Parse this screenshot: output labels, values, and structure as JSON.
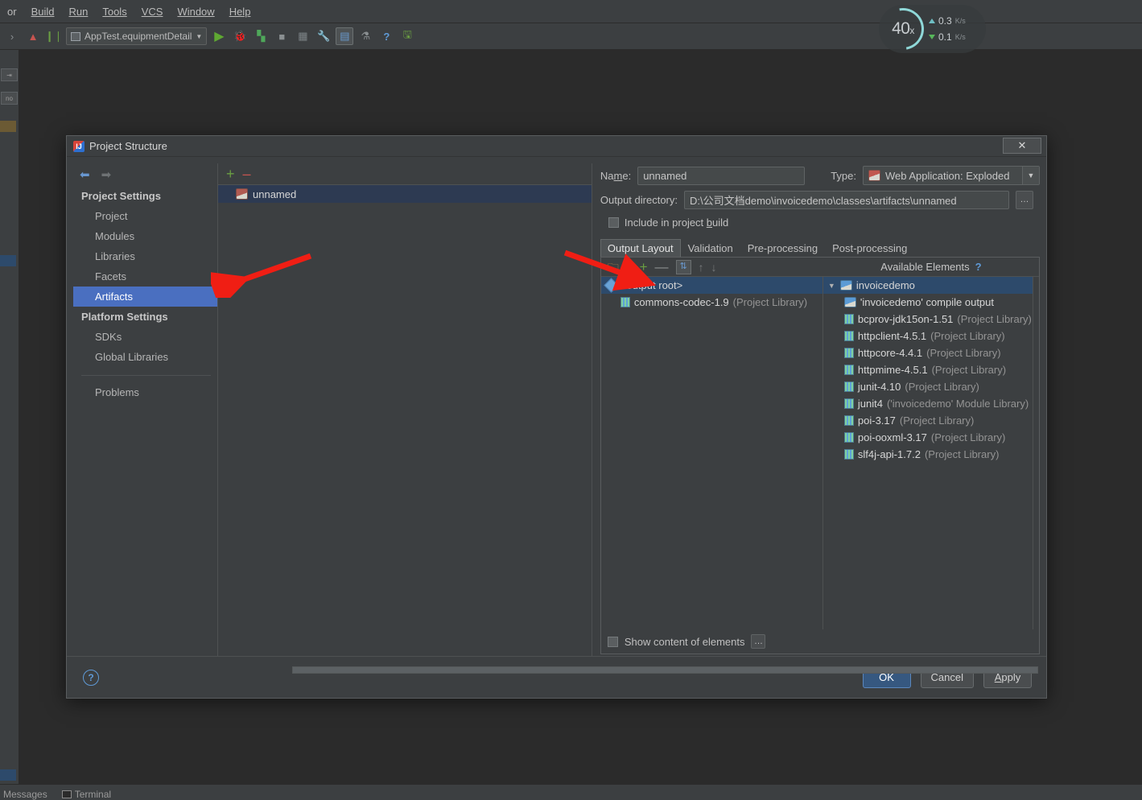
{
  "ide": {
    "menu": [
      "or",
      "Build",
      "Run",
      "Tools",
      "VCS",
      "Window",
      "Help"
    ],
    "run_config": "AppTest.equipmentDetail",
    "toolbar_icons": [
      "update-icon",
      "settings-sync-icon",
      "run-icon",
      "debug-icon",
      "coverage-icon",
      "stop-icon",
      "build-icon",
      "wrench-icon",
      "project-structure-icon",
      "attach-icon",
      "help-icon",
      "save-all-icon"
    ],
    "status_bar": [
      "Messages",
      "Terminal"
    ]
  },
  "net_widget": {
    "percent": "40",
    "percent_unit": "x",
    "upload": "0.3",
    "upload_unit": "K/s",
    "download": "0.1",
    "download_unit": "K/s"
  },
  "dialog": {
    "title": "Project Structure",
    "close_label": "✕",
    "nav": {
      "back": "⬅",
      "forward": "➡"
    },
    "sidebar": {
      "groups": [
        {
          "label": "Project Settings",
          "items": [
            {
              "label": "Project",
              "selected": false
            },
            {
              "label": "Modules",
              "selected": false
            },
            {
              "label": "Libraries",
              "selected": false
            },
            {
              "label": "Facets",
              "selected": false
            },
            {
              "label": "Artifacts",
              "selected": true
            }
          ]
        },
        {
          "label": "Platform Settings",
          "items": [
            {
              "label": "SDKs",
              "selected": false
            },
            {
              "label": "Global Libraries",
              "selected": false
            }
          ]
        }
      ],
      "extra": "Problems"
    },
    "artifacts": {
      "add_label": "+",
      "remove_label": "–",
      "items": [
        {
          "label": "unnamed",
          "selected": true
        }
      ]
    },
    "detail": {
      "name_label": "Name:",
      "name_value": "unnamed",
      "type_label": "Type:",
      "type_value": "Web Application: Exploded",
      "output_dir_label": "Output directory:",
      "output_dir_value": "D:\\公司文档demo\\invoicedemo\\classes\\artifacts\\unnamed",
      "browse_label": "…",
      "include_in_build_label": "Include in project build",
      "include_in_build_checked": false,
      "tabs": [
        {
          "label": "Output Layout",
          "active": true
        },
        {
          "label": "Validation",
          "active": false
        },
        {
          "label": "Pre-processing",
          "active": false
        },
        {
          "label": "Post-processing",
          "active": false
        }
      ],
      "panel_toolbar": [
        {
          "name": "create-directory-icon",
          "glyph": "🗀"
        },
        {
          "name": "create-archive-icon",
          "glyph": "▮"
        },
        {
          "name": "add-copy-icon",
          "glyph": "+"
        },
        {
          "name": "remove-icon",
          "glyph": "—"
        },
        {
          "name": "sort-icon",
          "glyph": "⇅"
        },
        {
          "name": "move-up-icon",
          "glyph": "↑"
        },
        {
          "name": "move-down-icon",
          "glyph": "↓"
        }
      ],
      "available_elements_label": "Available Elements",
      "available_help": "?",
      "output_layout_tree": [
        {
          "label": "<output root>",
          "sub": "",
          "selected": true,
          "indent": 0,
          "icon": "output-root-icon"
        },
        {
          "label": "commons-codec-1.9",
          "sub": "(Project Library)",
          "selected": false,
          "indent": 1,
          "icon": "library-icon"
        }
      ],
      "available_tree": {
        "root": {
          "label": "invoicedemo",
          "expanded": true,
          "selected": true
        },
        "children": [
          {
            "label": "'invoicedemo' compile output",
            "sub": "",
            "icon": "module-icon"
          },
          {
            "label": "bcprov-jdk15on-1.51",
            "sub": "(Project Library)",
            "icon": "library-icon"
          },
          {
            "label": "httpclient-4.5.1",
            "sub": "(Project Library)",
            "icon": "library-icon"
          },
          {
            "label": "httpcore-4.4.1",
            "sub": "(Project Library)",
            "icon": "library-icon"
          },
          {
            "label": "httpmime-4.5.1",
            "sub": "(Project Library)",
            "icon": "library-icon"
          },
          {
            "label": "junit-4.10",
            "sub": "(Project Library)",
            "icon": "library-icon"
          },
          {
            "label": "junit4",
            "sub": "('invoicedemo' Module Library)",
            "icon": "library-icon"
          },
          {
            "label": "poi-3.17",
            "sub": "(Project Library)",
            "icon": "library-icon"
          },
          {
            "label": "poi-ooxml-3.17",
            "sub": "(Project Library)",
            "icon": "library-icon"
          },
          {
            "label": "slf4j-api-1.7.2",
            "sub": "(Project Library)",
            "icon": "library-icon"
          }
        ]
      },
      "show_content_label": "Show content of elements",
      "show_content_checked": false,
      "show_content_dots": "…"
    },
    "footer": {
      "help": "?",
      "ok": "OK",
      "cancel": "Cancel",
      "apply": "Apply"
    }
  },
  "colors": {
    "accent_selection": "#4a6fc0",
    "tree_selection": "#2d4a6b",
    "annotation_arrow": "#f01e14",
    "primary_button": "#365880"
  }
}
